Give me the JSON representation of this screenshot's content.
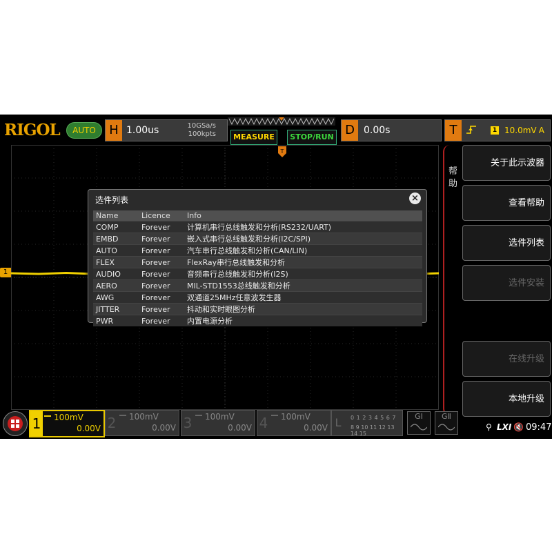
{
  "brand": {
    "logo": "RIGOL",
    "mode_badge": "AUTO"
  },
  "horizontal": {
    "letter": "H",
    "timebase": "1.00us",
    "sample_rate": "10GSa/s",
    "memory_depth": "100kpts"
  },
  "buttons": {
    "measure": "MEASURE",
    "stop_run": "STOP/RUN"
  },
  "delay": {
    "letter": "D",
    "value": "0.00s"
  },
  "trigger": {
    "letter": "T",
    "edge_icon": "rising-edge-icon",
    "source": "1",
    "level": "10.0mV",
    "mode": "A"
  },
  "dialog": {
    "title": "选件列表",
    "columns": [
      "Name",
      "Licence",
      "Info"
    ],
    "rows": [
      {
        "name": "COMP",
        "licence": "Forever",
        "info": "计算机串行总线触发和分析(RS232/UART)"
      },
      {
        "name": "EMBD",
        "licence": "Forever",
        "info": "嵌入式串行总线触发和分析(I2C/SPI)"
      },
      {
        "name": "AUTO",
        "licence": "Forever",
        "info": "汽车串行总线触发和分析(CAN/LIN)"
      },
      {
        "name": "FLEX",
        "licence": "Forever",
        "info": "FlexRay串行总线触发和分析"
      },
      {
        "name": "AUDIO",
        "licence": "Forever",
        "info": "音频串行总线触发和分析(I2S)"
      },
      {
        "name": "AERO",
        "licence": "Forever",
        "info": "MIL-STD1553总线触发和分析"
      },
      {
        "name": "AWG",
        "licence": "Forever",
        "info": "双通道25MHz任意波发生器"
      },
      {
        "name": "JITTER",
        "licence": "Forever",
        "info": "抖动和实时眼图分析"
      },
      {
        "name": "PWR",
        "licence": "Forever",
        "info": "内置电源分析"
      }
    ]
  },
  "menu": {
    "tab_label": "帮助",
    "items": [
      {
        "label": "关于此示波器",
        "enabled": true
      },
      {
        "label": "查看帮助",
        "enabled": true
      },
      {
        "label": "选件列表",
        "enabled": true
      },
      {
        "label": "选件安装",
        "enabled": false
      },
      {
        "label": "在线升级",
        "enabled": false
      },
      {
        "label": "本地升级",
        "enabled": true
      }
    ]
  },
  "channels": [
    {
      "num": "1",
      "scale": "100mV",
      "offset": "0.00V",
      "active": true
    },
    {
      "num": "2",
      "scale": "100mV",
      "offset": "0.00V",
      "active": false
    },
    {
      "num": "3",
      "scale": "100mV",
      "offset": "0.00V",
      "active": false
    },
    {
      "num": "4",
      "scale": "100mV",
      "offset": "0.00V",
      "active": false
    }
  ],
  "logic": {
    "letter": "L",
    "row1": "0 1 2 3 4 5 6 7",
    "row2": "8 9 10 11 12 13 14 15"
  },
  "generators": [
    {
      "label": "GⅠ"
    },
    {
      "label": "GⅡ"
    }
  ],
  "ch1_marker": "1",
  "status": {
    "lxi": "LXI",
    "time": "09:47"
  },
  "colors": {
    "ch1": "#f0d000",
    "accent": "#e07a10",
    "menu_border": "#b02020"
  }
}
